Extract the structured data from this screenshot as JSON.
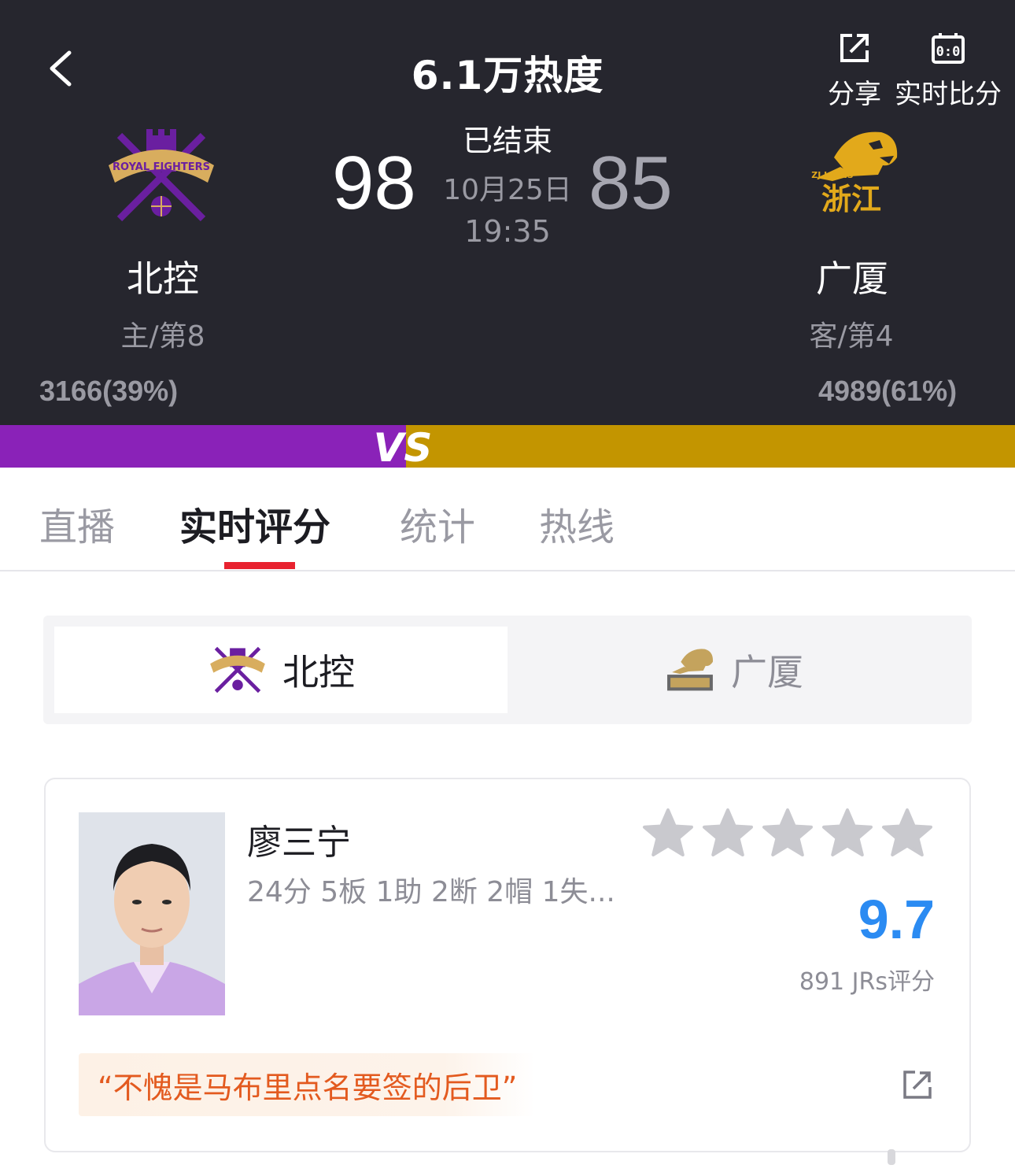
{
  "header": {
    "heat": "6.1万热度",
    "share_label": "分享",
    "live_score_label": "实时比分",
    "status": "已结束",
    "date": "10月25日",
    "time": "19:35"
  },
  "home_team": {
    "name": "北控",
    "rank": "主/第8",
    "score": "98",
    "votes": "3166(39%)",
    "color": "#8a22b8",
    "logo_text": "ROYAL FIGHTERS"
  },
  "away_team": {
    "name": "广厦",
    "rank": "客/第4",
    "score": "85",
    "votes": "4989(61%)",
    "color": "#c39500",
    "logo_text": "ZJ LIONS",
    "logo_text_cn": "浙江"
  },
  "vs_label": "VS",
  "tabs": [
    {
      "label": "直播"
    },
    {
      "label": "实时评分"
    },
    {
      "label": "统计"
    },
    {
      "label": "热线"
    }
  ],
  "active_tab": "实时评分",
  "team_switch": {
    "selected": "北控",
    "options": [
      "北控",
      "广厦"
    ]
  },
  "player": {
    "name": "廖三宁",
    "stats": "24分 5板 1助 2断 2帽 1失...",
    "rating": "9.7",
    "rating_count": "891 JRs评分",
    "stars": 5,
    "quote": "“不愧是马布里点名要签的后卫”"
  },
  "colors": {
    "accent_red": "#e8222f",
    "rating_blue": "#2b8bf2",
    "quote_orange": "#e35a1f",
    "header_bg": "#26262e"
  }
}
